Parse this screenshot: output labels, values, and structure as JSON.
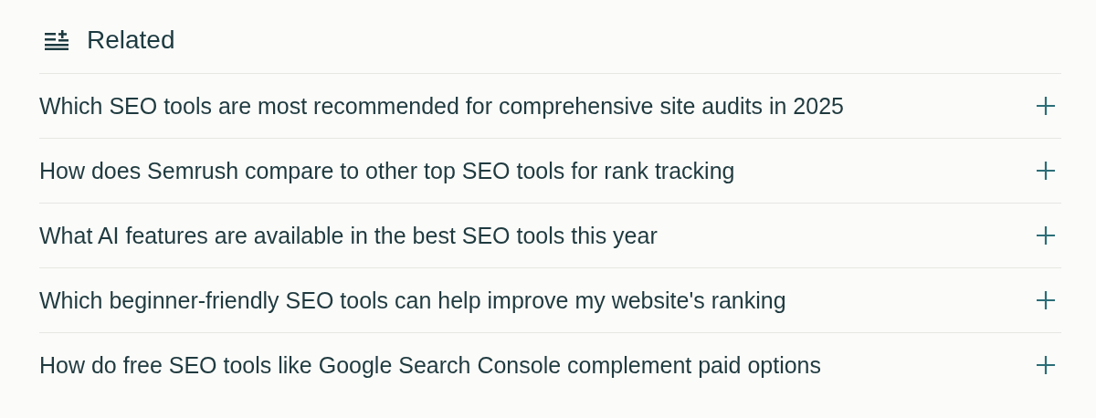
{
  "heading": "Related",
  "items": [
    {
      "text": "Which SEO tools are most recommended for comprehensive site audits in 2025"
    },
    {
      "text": "How does Semrush compare to other top SEO tools for rank tracking"
    },
    {
      "text": "What AI features are available in the best SEO tools this year"
    },
    {
      "text": "Which beginner-friendly SEO tools can help improve my website's ranking"
    },
    {
      "text": "How do free SEO tools like Google Search Console complement paid options"
    }
  ]
}
